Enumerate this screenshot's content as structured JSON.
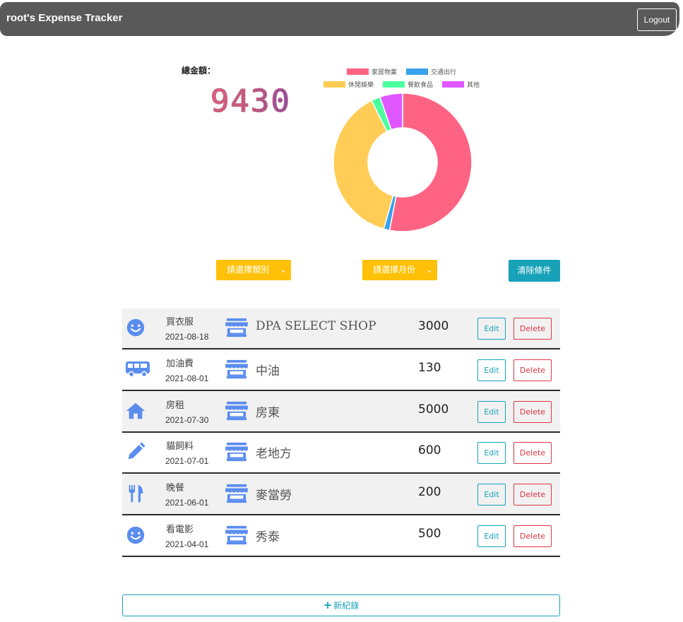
{
  "app": {
    "title": "root's Expense Tracker",
    "logout_label": "Logout"
  },
  "summary": {
    "total_label": "總金額：",
    "total_amount": "9430"
  },
  "chart_data": {
    "type": "pie",
    "title": "",
    "legend_position": "top",
    "categories": [
      "家居物業",
      "交通出行",
      "休閒娛樂",
      "餐飲食品",
      "其他"
    ],
    "values": [
      5000,
      130,
      3600,
      200,
      500
    ],
    "colors": [
      "#ff6384",
      "#36a2eb",
      "#ffcd56",
      "#4bff9f",
      "#e057ff"
    ]
  },
  "filters": {
    "category_placeholder": "請選擇類別",
    "month_placeholder": "請選擇月份",
    "clear_label": "清除條件"
  },
  "records": [
    {
      "icon": "smile-icon",
      "name": "買衣服",
      "date": "2021-08-18",
      "merchant": "DPA SELECT SHOP",
      "amount": "3000"
    },
    {
      "icon": "bus-icon",
      "name": "加油費",
      "date": "2021-08-01",
      "merchant": "中油",
      "amount": "130"
    },
    {
      "icon": "home-icon",
      "name": "房租",
      "date": "2021-07-30",
      "merchant": "房東",
      "amount": "5000"
    },
    {
      "icon": "pencil-icon",
      "name": "貓飼料",
      "date": "2021-07-01",
      "merchant": "老地方",
      "amount": "600"
    },
    {
      "icon": "utensils-icon",
      "name": "晚餐",
      "date": "2021-06-01",
      "merchant": "麥當勞",
      "amount": "200"
    },
    {
      "icon": "smile-icon",
      "name": "看電影",
      "date": "2021-04-01",
      "merchant": "秀泰",
      "amount": "500"
    }
  ],
  "row_actions": {
    "edit_label": "Edit",
    "delete_label": "Delete"
  },
  "add_button": {
    "label": "新紀錄"
  },
  "theme": {
    "icon_color": "#5b8def",
    "navbar_color": "#595959",
    "warning_color": "#ffc107",
    "info_color": "#17a2b8",
    "danger_color": "#dc3545"
  }
}
